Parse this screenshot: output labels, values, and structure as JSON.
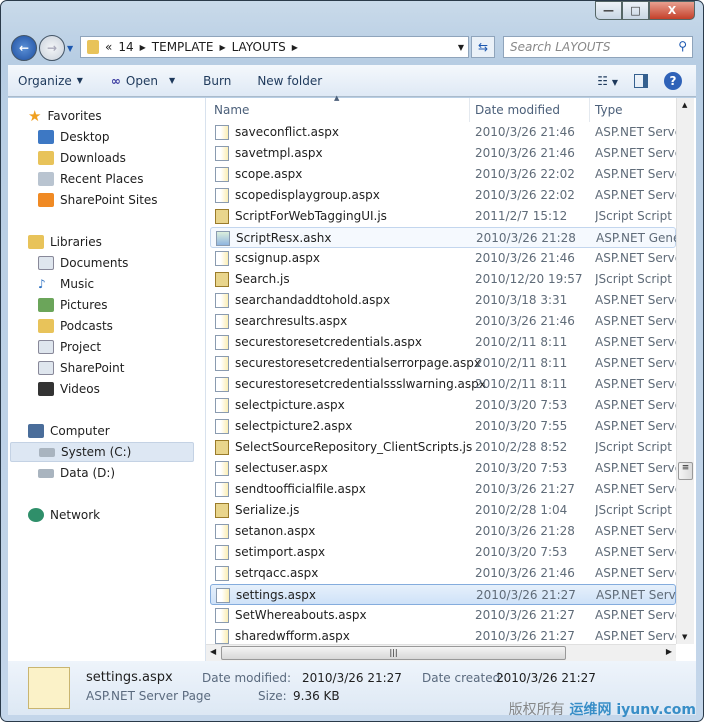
{
  "window": {
    "minimize": "—",
    "maximize": "□",
    "close": "X"
  },
  "address": {
    "chevron": "«",
    "crumbs": [
      "14",
      "TEMPLATE",
      "LAYOUTS"
    ],
    "search_placeholder": "Search LAYOUTS"
  },
  "toolbar": {
    "organize": "Organize",
    "open": "Open",
    "burn": "Burn",
    "new_folder": "New folder",
    "help": "?"
  },
  "sidebar": {
    "favorites": {
      "label": "Favorites",
      "items": [
        "Desktop",
        "Downloads",
        "Recent Places",
        "SharePoint Sites"
      ]
    },
    "libraries": {
      "label": "Libraries",
      "items": [
        "Documents",
        "Music",
        "Pictures",
        "Podcasts",
        "Project",
        "SharePoint",
        "Videos"
      ]
    },
    "computer": {
      "label": "Computer",
      "items": [
        "System (C:)",
        "Data (D:)"
      ],
      "selected": "System (C:)"
    },
    "network": {
      "label": "Network"
    }
  },
  "columns": {
    "name": "Name",
    "date": "Date modified",
    "type": "Type"
  },
  "files": [
    {
      "name": "saveconflict.aspx",
      "date": "2010/3/26 21:46",
      "type": "ASP.NET Server",
      "kind": "aspx"
    },
    {
      "name": "savetmpl.aspx",
      "date": "2010/3/26 21:46",
      "type": "ASP.NET Server",
      "kind": "aspx"
    },
    {
      "name": "scope.aspx",
      "date": "2010/3/26 22:02",
      "type": "ASP.NET Server",
      "kind": "aspx"
    },
    {
      "name": "scopedisplaygroup.aspx",
      "date": "2010/3/26 22:02",
      "type": "ASP.NET Server",
      "kind": "aspx"
    },
    {
      "name": "ScriptForWebTaggingUI.js",
      "date": "2011/2/7 15:12",
      "type": "JScript Script Fil",
      "kind": "js"
    },
    {
      "name": "ScriptResx.ashx",
      "date": "2010/3/26 21:28",
      "type": "ASP.NET Gener",
      "kind": "ashx"
    },
    {
      "name": "scsignup.aspx",
      "date": "2010/3/26 21:46",
      "type": "ASP.NET Server",
      "kind": "aspx"
    },
    {
      "name": "Search.js",
      "date": "2010/12/20 19:57",
      "type": "JScript Script Fil",
      "kind": "js"
    },
    {
      "name": "searchandaddtohold.aspx",
      "date": "2010/3/18 3:31",
      "type": "ASP.NET Server",
      "kind": "aspx"
    },
    {
      "name": "searchresults.aspx",
      "date": "2010/3/26 21:46",
      "type": "ASP.NET Server",
      "kind": "aspx"
    },
    {
      "name": "securestoresetcredentials.aspx",
      "date": "2010/2/11 8:11",
      "type": "ASP.NET Server",
      "kind": "aspx"
    },
    {
      "name": "securestoresetcredentialserrorpage.aspx",
      "date": "2010/2/11 8:11",
      "type": "ASP.NET Server",
      "kind": "aspx"
    },
    {
      "name": "securestoresetcredentialssslwarning.aspx",
      "date": "2010/2/11 8:11",
      "type": "ASP.NET Server",
      "kind": "aspx"
    },
    {
      "name": "selectpicture.aspx",
      "date": "2010/3/20 7:53",
      "type": "ASP.NET Server",
      "kind": "aspx"
    },
    {
      "name": "selectpicture2.aspx",
      "date": "2010/3/20 7:55",
      "type": "ASP.NET Server",
      "kind": "aspx"
    },
    {
      "name": "SelectSourceRepository_ClientScripts.js",
      "date": "2010/2/28 8:52",
      "type": "JScript Script Fil",
      "kind": "js"
    },
    {
      "name": "selectuser.aspx",
      "date": "2010/3/20 7:53",
      "type": "ASP.NET Server",
      "kind": "aspx"
    },
    {
      "name": "sendtoofficialfile.aspx",
      "date": "2010/3/26 21:27",
      "type": "ASP.NET Server",
      "kind": "aspx"
    },
    {
      "name": "Serialize.js",
      "date": "2010/2/28 1:04",
      "type": "JScript Script Fil",
      "kind": "js"
    },
    {
      "name": "setanon.aspx",
      "date": "2010/3/26 21:28",
      "type": "ASP.NET Server",
      "kind": "aspx"
    },
    {
      "name": "setimport.aspx",
      "date": "2010/3/20 7:53",
      "type": "ASP.NET Server",
      "kind": "aspx"
    },
    {
      "name": "setrqacc.aspx",
      "date": "2010/3/26 21:46",
      "type": "ASP.NET Server",
      "kind": "aspx"
    },
    {
      "name": "settings.aspx",
      "date": "2010/3/26 21:27",
      "type": "ASP.NET Server",
      "kind": "aspx",
      "selected": true
    },
    {
      "name": "SetWhereabouts.aspx",
      "date": "2010/3/26 21:27",
      "type": "ASP.NET Server",
      "kind": "aspx"
    },
    {
      "name": "sharedwfform.aspx",
      "date": "2010/3/26 21:27",
      "type": "ASP.NET Server",
      "kind": "aspx"
    }
  ],
  "details": {
    "name": "settings.aspx",
    "type": "ASP.NET Server Page",
    "modified_label": "Date modified:",
    "modified": "2010/3/26 21:27",
    "created_label": "Date created:",
    "created": "2010/3/26 21:27",
    "size_label": "Size:",
    "size": "9.36 KB"
  },
  "watermark": {
    "text": "运维网 iyunv.com",
    "caption": "版权所有"
  }
}
